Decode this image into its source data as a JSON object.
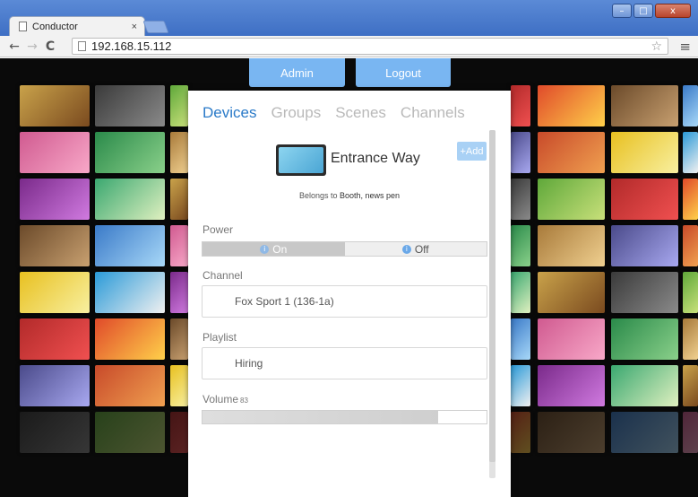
{
  "browser": {
    "tab_title": "Conductor",
    "tab_close": "×",
    "url": "192.168.15.112",
    "back": "←",
    "forward": "→",
    "reload": "C",
    "star": "☆",
    "menu": "≡",
    "win_min": "–",
    "win_max": "□",
    "win_close": "x"
  },
  "header": {
    "admin_label": "Admin",
    "logout_label": "Logout"
  },
  "tabs": [
    "Devices",
    "Groups",
    "Scenes",
    "Channels"
  ],
  "device": {
    "name": "Entrance Way",
    "add_label": "+Add",
    "belongs_prefix": "Belongs to",
    "belongs_value": "Booth, news pen"
  },
  "power": {
    "label": "Power",
    "on_label": "On",
    "off_label": "Off",
    "state": "on"
  },
  "channel": {
    "label": "Channel",
    "value": "Fox Sport 1 (136-1a)"
  },
  "playlist": {
    "label": "Playlist",
    "value": "Hiring"
  },
  "volume": {
    "label": "Volume",
    "value": "83",
    "level": 0.83
  },
  "colors": {
    "accent": "#2a7ac8",
    "button": "#79b6f2",
    "add_button": "#a9d1f5"
  }
}
